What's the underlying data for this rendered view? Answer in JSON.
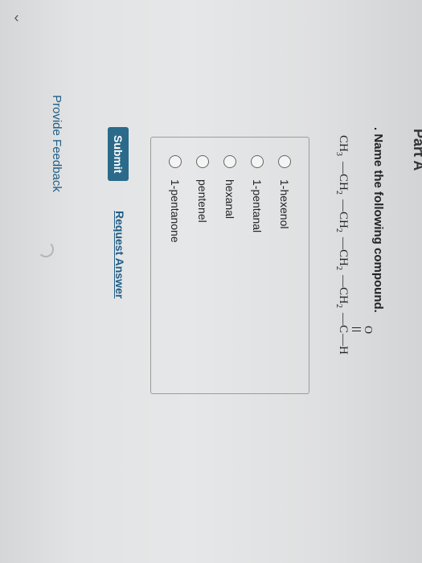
{
  "part_title": "Part A",
  "question": {
    "prompt": ". Name the following compound.",
    "formula_atoms": [
      "CH",
      "CH",
      "CH",
      "CH",
      "CH",
      "C",
      "H"
    ],
    "formula_subscripts": [
      "3",
      "2",
      "2",
      "2",
      "2"
    ],
    "formula_bond": "—",
    "carbonyl_oxygen": "O"
  },
  "options": [
    {
      "label": "1-hexenol",
      "selected": false
    },
    {
      "label": "1-pentanal",
      "selected": false
    },
    {
      "label": "hexanal",
      "selected": false
    },
    {
      "label": "pentenel",
      "selected": false
    },
    {
      "label": "1-pentanone",
      "selected": false
    }
  ],
  "buttons": {
    "submit": "Submit",
    "request_answer": "Request Answer"
  },
  "feedback_link": "Provide Feedback",
  "icons": {
    "collapse": "chevron-right-icon",
    "radio": "radio-button-icon",
    "cursor": "loading-cursor-icon"
  },
  "colors": {
    "submit_bg": "#2b6a8a",
    "link": "#1f5e86"
  }
}
